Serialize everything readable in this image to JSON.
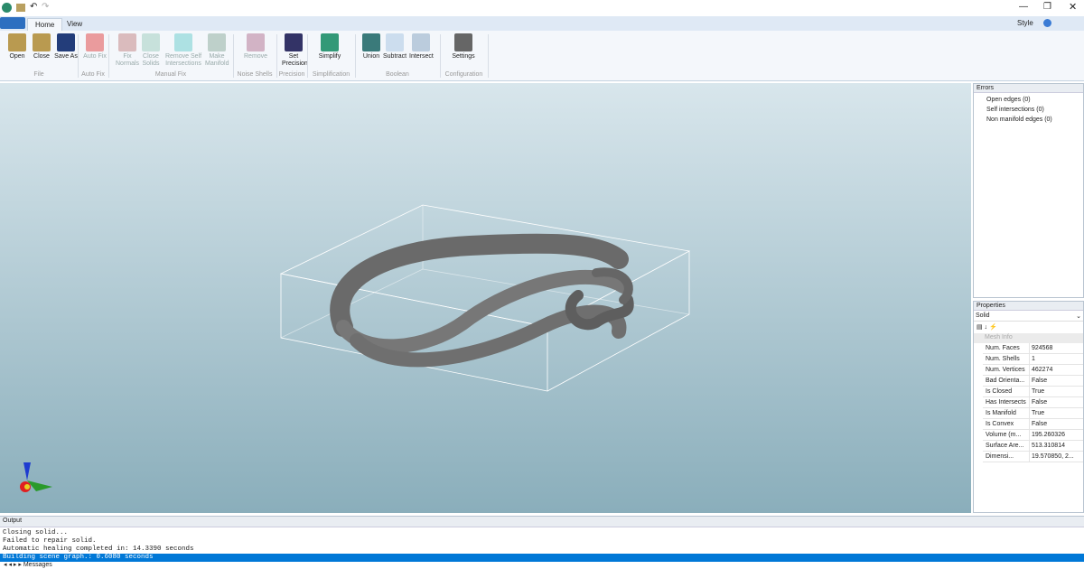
{
  "tabs": [
    "Home",
    "View"
  ],
  "window": {
    "style_label": "Style"
  },
  "ribbon": {
    "buttons": [
      {
        "label": "Open",
        "icon": "open-folder-icon"
      },
      {
        "label": "Close",
        "icon": "close-folder-icon"
      },
      {
        "label": "Save As",
        "icon": "save-icon"
      },
      {
        "label": "Auto Fix",
        "icon": "red-cross-icon"
      },
      {
        "label": "Fix Normals",
        "icon": "fix-normals-icon"
      },
      {
        "label": "Close Solids",
        "icon": "close-solids-icon"
      },
      {
        "label": "Remove Self Intersections",
        "icon": "star-icon"
      },
      {
        "label": "Make Manifold",
        "icon": "manifold-icon"
      },
      {
        "label": "Remove",
        "icon": "remove-shells-icon"
      },
      {
        "label": "Set Precision",
        "icon": "precision-icon"
      },
      {
        "label": "Simplify",
        "icon": "simplify-icon"
      },
      {
        "label": "Union",
        "icon": "union-icon"
      },
      {
        "label": "Subtract",
        "icon": "subtract-icon"
      },
      {
        "label": "Intersect",
        "icon": "intersect-icon"
      },
      {
        "label": "Settings",
        "icon": "gear-icon"
      }
    ],
    "groups": [
      "File",
      "Auto Fix",
      "Manual Fix",
      "Noise Shells",
      "Precision",
      "Simplification",
      "Boolean",
      "Configuration"
    ]
  },
  "errors": {
    "title": "Errors",
    "items": [
      "Open edges (0)",
      "Self intersections (0)",
      "Non manifold edges (0)"
    ]
  },
  "properties": {
    "title": "Properties",
    "selected": "Solid",
    "section": "Mesh Info",
    "rows": [
      [
        "Num. Faces",
        "924568"
      ],
      [
        "Num. Shells",
        "1"
      ],
      [
        "Num. Vertices",
        "462274"
      ],
      [
        "Bad Orienta...",
        "False"
      ],
      [
        "Is Closed",
        "True"
      ],
      [
        "Has Intersects",
        "False"
      ],
      [
        "Is Manifold",
        "True"
      ],
      [
        "Is Convex",
        "False"
      ],
      [
        "Volume (m...",
        "195.260326"
      ],
      [
        "Surface Are...",
        "513.310814"
      ],
      [
        "Dimensi...",
        "19.570850, 2..."
      ]
    ]
  },
  "output": {
    "title": "Output",
    "lines": [
      "Closing solid...",
      "Failed to repair solid.",
      "Automatic healing completed in: 14.3390 seconds",
      "Building scene graph.: 0.6080 seconds"
    ],
    "tab": "Messages"
  },
  "colors": {
    "accent": "#0078d7",
    "model": "#6e6e6e"
  }
}
